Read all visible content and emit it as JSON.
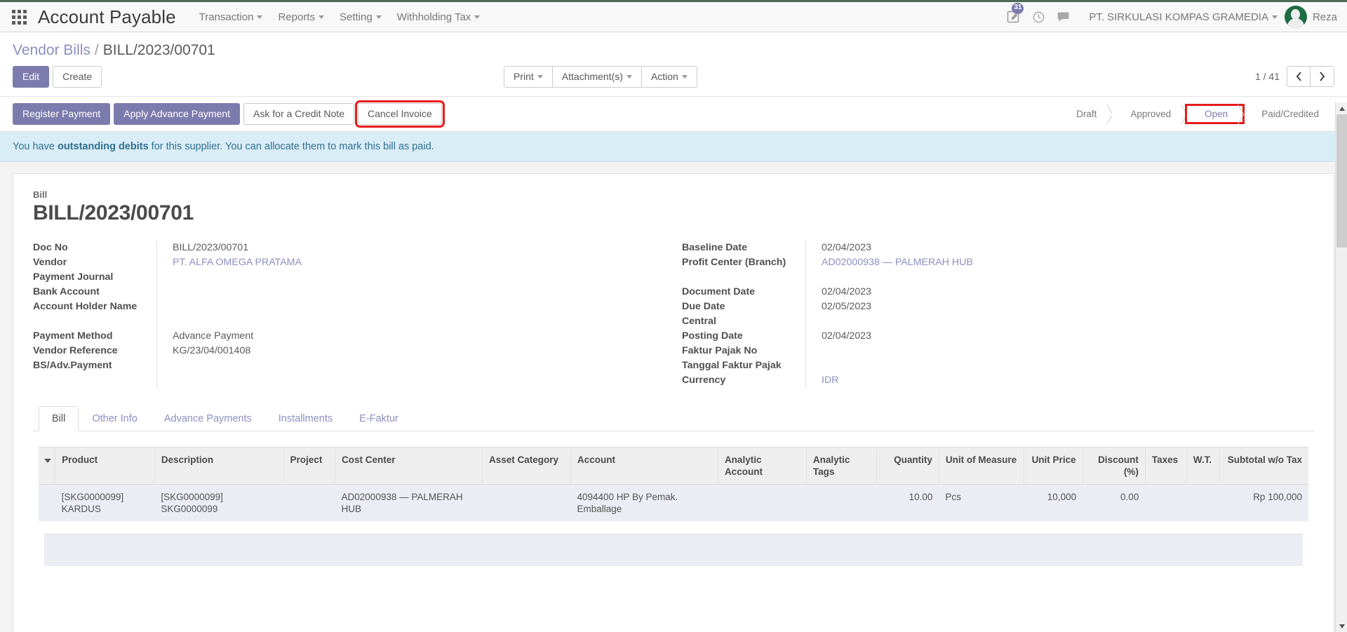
{
  "topbar": {
    "apps_icon": "apps-grid-icon",
    "brand": "Account Payable",
    "menus": [
      {
        "label": "Transaction"
      },
      {
        "label": "Reports"
      },
      {
        "label": "Setting"
      },
      {
        "label": "Withholding Tax"
      }
    ],
    "activity_badge": "31",
    "activity_icon": "edit-note-icon",
    "clock_icon": "clock-icon",
    "messages_icon": "chat-bubble-icon",
    "company": "PT. SIRKULASI KOMPAS GRAMEDIA",
    "username": "Reza"
  },
  "control_panel": {
    "breadcrumb_parent": "Vendor Bills",
    "breadcrumb_sep": "/",
    "breadcrumb_current": "BILL/2023/00701",
    "edit_label": "Edit",
    "create_label": "Create",
    "print_label": "Print",
    "attachments_label": "Attachment(s)",
    "action_label": "Action",
    "pager_label": "1 / 41",
    "prev_icon": "chevron-left-icon",
    "next_icon": "chevron-right-icon"
  },
  "statusbar": {
    "buttons": [
      {
        "label": "Register Payment",
        "style": "primary",
        "highlight": false
      },
      {
        "label": "Apply Advance Payment",
        "style": "primary",
        "highlight": false
      },
      {
        "label": "Ask for a Credit Note",
        "style": "default",
        "highlight": false
      },
      {
        "label": "Cancel Invoice",
        "style": "default",
        "highlight": true
      }
    ],
    "stages": [
      {
        "label": "Draft",
        "active": false,
        "highlight": false
      },
      {
        "label": "Approved",
        "active": false,
        "highlight": false
      },
      {
        "label": "Open",
        "active": true,
        "highlight": true
      },
      {
        "label": "Paid/Credited",
        "active": false,
        "highlight": false
      }
    ]
  },
  "alert": {
    "prefix": "You have ",
    "bold": "outstanding debits",
    "suffix": " for this supplier. You can allocate them to mark this bill as paid."
  },
  "sheet": {
    "subtitle": "Bill",
    "title": "BILL/2023/00701",
    "left_fields": [
      {
        "label": "Doc No",
        "value": "BILL/2023/00701",
        "link": false
      },
      {
        "label": "Vendor",
        "value": "PT. ALFA OMEGA PRATAMA",
        "link": true
      },
      {
        "label": "Payment Journal",
        "value": "",
        "link": false
      },
      {
        "label": "Bank Account",
        "value": "",
        "link": false
      },
      {
        "label": "Account Holder Name",
        "value": "",
        "link": false,
        "two_line": true
      },
      {
        "label": "Payment Method",
        "value": "Advance Payment",
        "link": false
      },
      {
        "label": "Vendor Reference",
        "value": "KG/23/04/001408",
        "link": false
      },
      {
        "label": "BS/Adv.Payment",
        "value": "",
        "link": false
      }
    ],
    "right_fields": [
      {
        "label": "Baseline Date",
        "value": "02/04/2023",
        "link": false
      },
      {
        "label": "Profit Center (Branch)",
        "value": "AD02000938 — PALMERAH HUB",
        "link": true,
        "two_line": true
      },
      {
        "label": "Document Date",
        "value": "02/04/2023",
        "link": false
      },
      {
        "label": "Due Date",
        "value": "02/05/2023",
        "link": false
      },
      {
        "label": "Central",
        "value": "",
        "link": false
      },
      {
        "label": "Posting Date",
        "value": "02/04/2023",
        "link": false
      },
      {
        "label": "Faktur Pajak No",
        "value": "",
        "link": false
      },
      {
        "label": "Tanggal Faktur Pajak",
        "value": "",
        "link": false
      },
      {
        "label": "Currency",
        "value": "IDR",
        "link": true
      }
    ],
    "tabs": [
      {
        "label": "Bill",
        "active": true
      },
      {
        "label": "Other Info",
        "active": false
      },
      {
        "label": "Advance Payments",
        "active": false
      },
      {
        "label": "Installments",
        "active": false
      },
      {
        "label": "E-Faktur",
        "active": false
      }
    ],
    "table": {
      "columns": [
        {
          "label": "Product",
          "align": "left"
        },
        {
          "label": "Description",
          "align": "left"
        },
        {
          "label": "Project",
          "align": "left"
        },
        {
          "label": "Cost Center",
          "align": "left"
        },
        {
          "label": "Asset Category",
          "align": "left"
        },
        {
          "label": "Account",
          "align": "left"
        },
        {
          "label": "Analytic Account",
          "align": "left"
        },
        {
          "label": "Analytic Tags",
          "align": "left"
        },
        {
          "label": "Quantity",
          "align": "right"
        },
        {
          "label": "Unit of Measure",
          "align": "left"
        },
        {
          "label": "Unit Price",
          "align": "right"
        },
        {
          "label": "Discount (%)",
          "align": "right"
        },
        {
          "label": "Taxes",
          "align": "left"
        },
        {
          "label": "W.T.",
          "align": "left"
        },
        {
          "label": "Subtotal w/o Tax",
          "align": "right"
        }
      ],
      "rows": [
        {
          "product": "[SKG0000099] KARDUS",
          "description": "[SKG0000099] SKG0000099",
          "project": "",
          "cost_center": "AD02000938 — PALMERAH HUB",
          "asset_category": "",
          "account": "4094400 HP By Pemak. Emballage",
          "analytic_account": "",
          "analytic_tags": "",
          "quantity": "10.00",
          "uom": "Pcs",
          "unit_price": "10,000",
          "discount": "0.00",
          "taxes": "",
          "wt": "",
          "subtotal": "Rp 100,000"
        }
      ]
    }
  }
}
